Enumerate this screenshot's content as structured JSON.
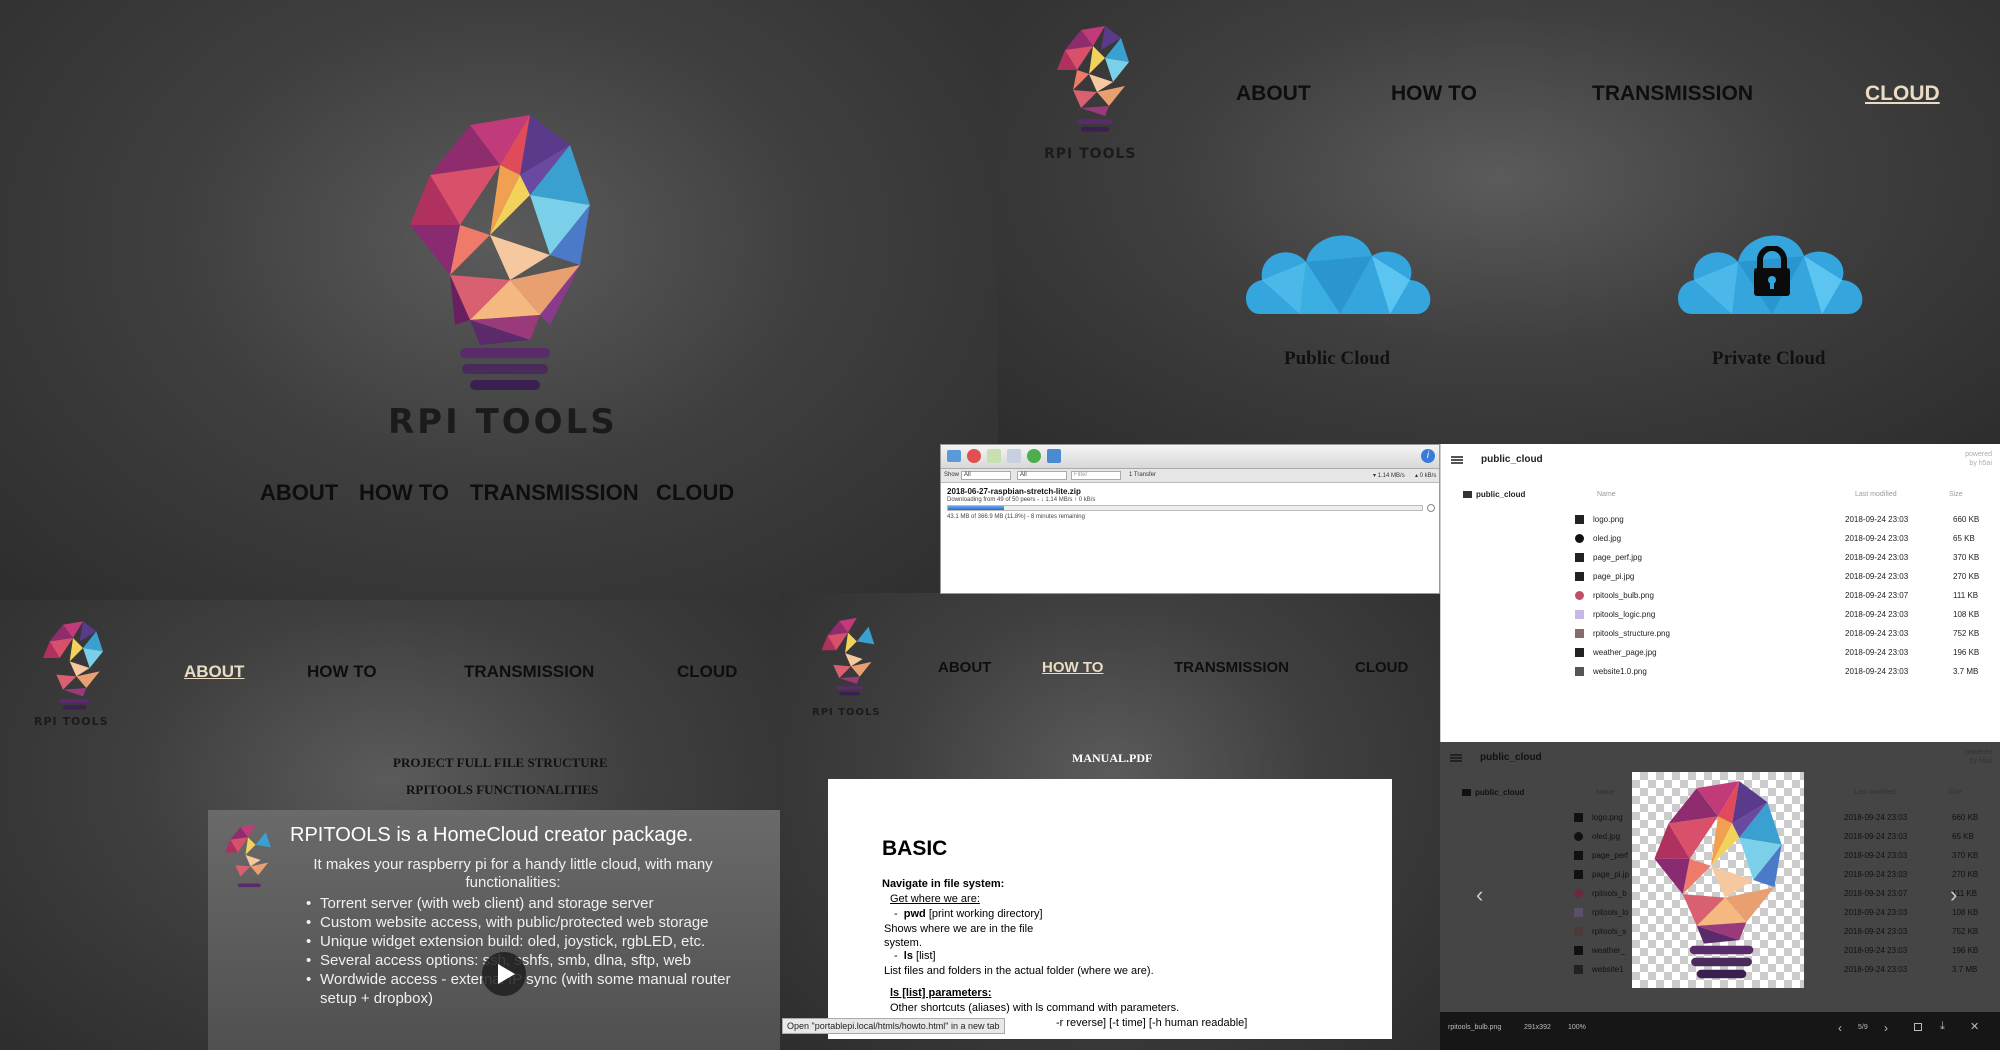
{
  "home": {
    "logo_text": "RPI TOOLS",
    "nav": [
      "ABOUT",
      "HOW TO",
      "TRANSMISSION",
      "CLOUD"
    ]
  },
  "cloud_page": {
    "logo_text": "RPI TOOLS",
    "nav": [
      "ABOUT",
      "HOW TO",
      "TRANSMISSION",
      "CLOUD"
    ],
    "active": "CLOUD",
    "public_label": "Public Cloud",
    "private_label": "Private Cloud"
  },
  "transmission": {
    "filter_show": "Show",
    "filter_all_1": "All",
    "filter_all_2": "All",
    "filter_placeholder": "Filter",
    "transfer_count": "1 Transfer",
    "speed_down": "▾ 1.14 MB/s",
    "speed_up": "▴ 0 kB/s",
    "torrent_name": "2018-06-27-raspbian-stretch-lite.zip",
    "torrent_status": "Downloading from 49 of 50 peers - ↓ 1.14 MB/s ↑ 0 kB/s",
    "torrent_progress_text": "43.1 MB of 366.9 MB (11.8%) - 8 minutes remaining",
    "progress": 0.118
  },
  "filebrowser": {
    "title": "public_cloud",
    "powered_by": "powered",
    "powered_by2": "by h5ai",
    "folder": "public_cloud",
    "col_name": "Name",
    "col_modified": "Last modified",
    "col_size": "Size",
    "files": [
      {
        "name": "logo.png",
        "date": "2018-09-24 23:03",
        "size": "660 KB"
      },
      {
        "name": "oled.jpg",
        "date": "2018-09-24 23:03",
        "size": "65 KB"
      },
      {
        "name": "page_perf.jpg",
        "date": "2018-09-24 23:03",
        "size": "370 KB"
      },
      {
        "name": "page_pi.jpg",
        "date": "2018-09-24 23:03",
        "size": "270 KB"
      },
      {
        "name": "rpitools_bulb.png",
        "date": "2018-09-24 23:07",
        "size": "111 KB"
      },
      {
        "name": "rpitools_logic.png",
        "date": "2018-09-24 23:03",
        "size": "108 KB"
      },
      {
        "name": "rpitools_structure.png",
        "date": "2018-09-24 23:03",
        "size": "752 KB"
      },
      {
        "name": "weather_page.jpg",
        "date": "2018-09-24 23:03",
        "size": "196 KB"
      },
      {
        "name": "website1.0.png",
        "date": "2018-09-24 23:03",
        "size": "3.7 MB"
      }
    ]
  },
  "viewer": {
    "title": "public_cloud",
    "powered_by": "powered",
    "powered_by2": "by h5ai",
    "folder": "public_cloud",
    "col_name": "Name",
    "col_modified": "Last modified",
    "col_size": "Size",
    "files": [
      {
        "name": "logo.png",
        "date": "2018-09-24 23:03",
        "size": "660 KB"
      },
      {
        "name": "oled.jpg",
        "date": "2018-09-24 23:03",
        "size": "65 KB"
      },
      {
        "name": "page_perf",
        "date": "2018-09-24 23:03",
        "size": "370 KB"
      },
      {
        "name": "page_pi.jp",
        "date": "2018-09-24 23:03",
        "size": "270 KB"
      },
      {
        "name": "rpitools_b",
        "date": "2018-09-24 23:07",
        "size": "111 KB"
      },
      {
        "name": "rpitools_lo",
        "date": "2018-09-24 23:03",
        "size": "108 KB"
      },
      {
        "name": "rpitools_s",
        "date": "2018-09-24 23:03",
        "size": "752 KB"
      },
      {
        "name": "weather_",
        "date": "2018-09-24 23:03",
        "size": "196 KB"
      },
      {
        "name": "website1",
        "date": "2018-09-24 23:03",
        "size": "3.7 MB"
      }
    ],
    "file_name": "rpitools_bulb.png",
    "dims": "291x392",
    "zoom": "100%",
    "counter": "5/9"
  },
  "about_page": {
    "logo_text": "RPI TOOLS",
    "nav": [
      "ABOUT",
      "HOW TO",
      "TRANSMISSION",
      "CLOUD"
    ],
    "active": "ABOUT",
    "link1": "PROJECT FULL FILE STRUCTURE",
    "link2": "RPITOOLS FUNCTIONALITIES",
    "video_title": "RPITOOLS  is a HomeCloud creator package.",
    "video_sub": "It makes your raspberry pi for a handy little cloud, with many functionalities:",
    "bullets": [
      "Torrent server (with web client) and storage server",
      "Custom website access, with public/protected web storage",
      "Unique widget extension build: oled, joystick, rgbLED, etc.",
      "Several access options: ssh, sshfs, smb, dlna, sftp, web",
      "Wordwide access - external IP sync (with some manual router setup + dropbox)"
    ]
  },
  "howto_page": {
    "logo_text": "RPI TOOLS",
    "nav": [
      "ABOUT",
      "HOW TO",
      "TRANSMISSION",
      "CLOUD"
    ],
    "active": "HOW TO",
    "manual_title": "MANUAL.PDF",
    "doc_heading": "BASIC",
    "doc_section": "Navigate in file system:",
    "doc_sub1": "Get where we are:",
    "doc_pwd": "pwd",
    "doc_pwd_desc": "[print working directory]",
    "doc_pwd_text": "Shows where we are in the file system.",
    "doc_ls": "ls",
    "doc_ls_desc": "[list]",
    "doc_ls_text": "List files and folders in the actual folder (where we are).",
    "doc_sub2": "ls [list] parameters:",
    "doc_aliases": "Other shortcuts (aliases) with ls command with parameters.",
    "doc_params": "-r reverse] [-t time] [-h human readable]",
    "status_link": "Open \"portablepi.local/htmls/howto.html\" in a new tab"
  }
}
